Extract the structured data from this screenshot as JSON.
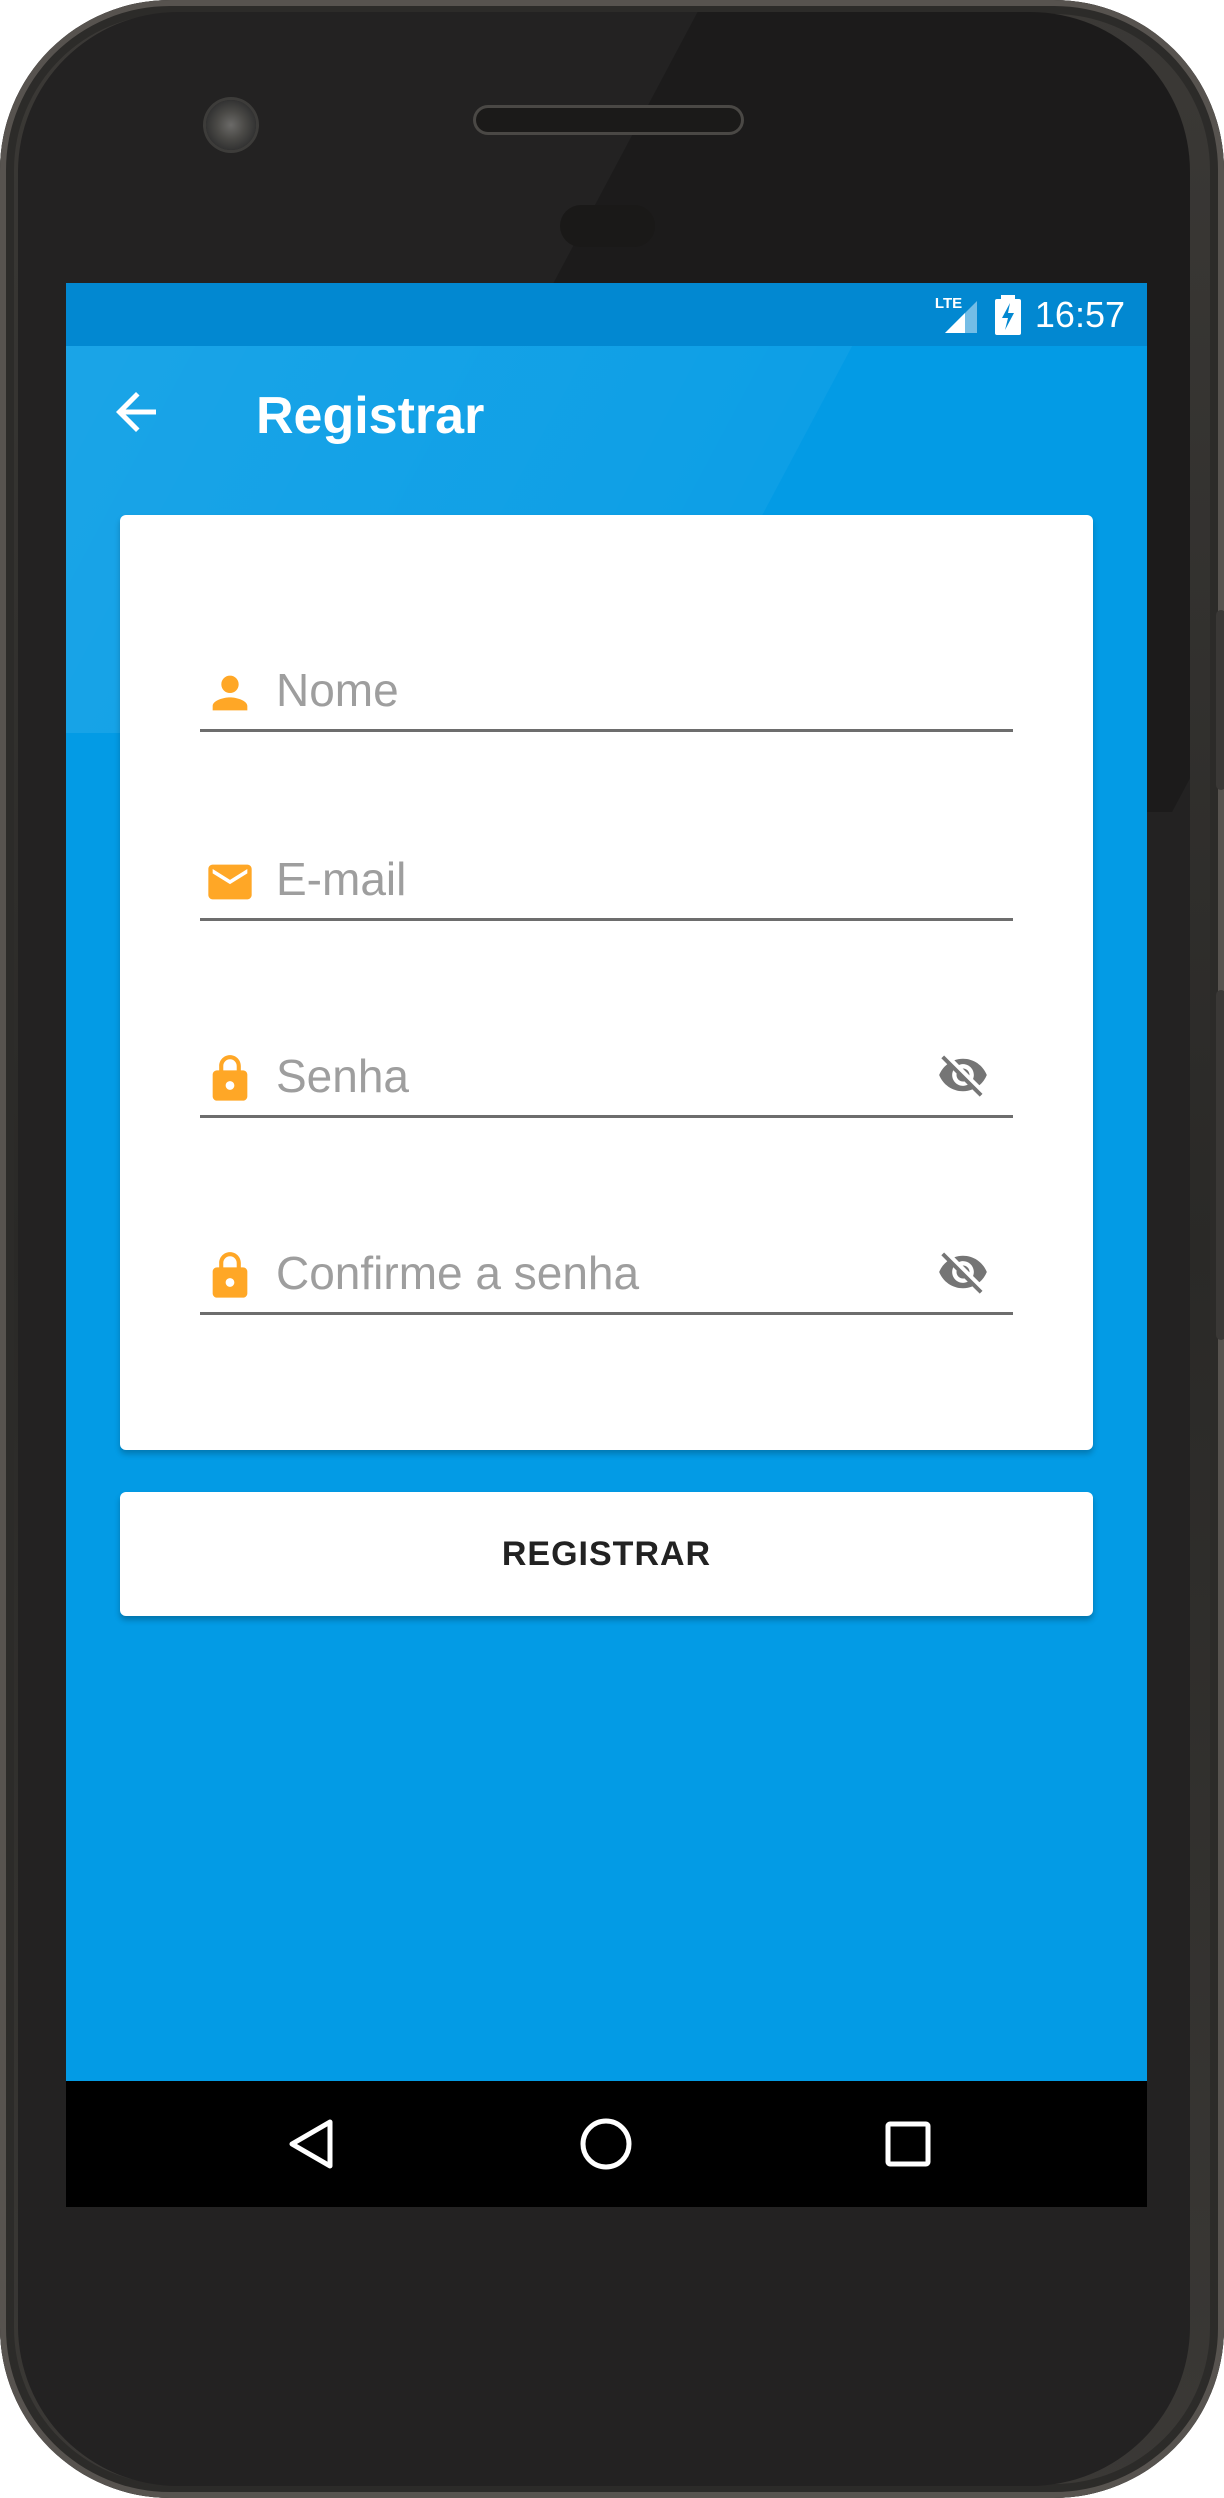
{
  "status_bar": {
    "network": "LTE",
    "time": "16:57"
  },
  "app_bar": {
    "title": "Registrar",
    "back_icon": "arrow-left-icon"
  },
  "form": {
    "name": {
      "placeholder": "Nome",
      "value": "",
      "icon": "person-icon"
    },
    "email": {
      "placeholder": "E-mail",
      "value": "",
      "icon": "email-icon"
    },
    "password": {
      "placeholder": "Senha",
      "value": "",
      "icon": "lock-icon",
      "toggle_icon": "eye-off-icon"
    },
    "confirm_password": {
      "placeholder": "Confirme a senha",
      "value": "",
      "icon": "lock-icon",
      "toggle_icon": "eye-off-icon"
    }
  },
  "register_button": {
    "label": "REGISTRAR"
  },
  "nav_bar": {
    "back": "triangle-back-icon",
    "home": "circle-home-icon",
    "recents": "square-recents-icon"
  },
  "colors": {
    "primary": "#039be5",
    "primary_dark": "#0288d1",
    "icon_accent": "#ffa726",
    "card": "#ffffff"
  }
}
